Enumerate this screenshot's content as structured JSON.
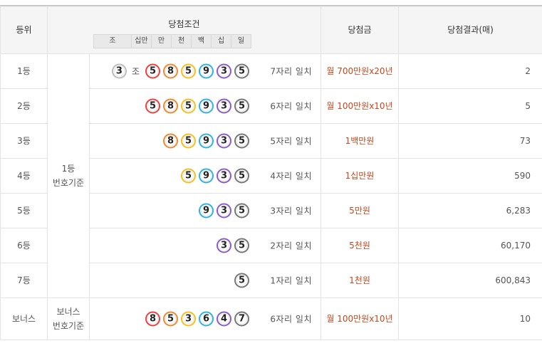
{
  "header": {
    "rank": "등위",
    "condition": "당첨조건",
    "prize": "당첨금",
    "result": "당첨결과(매)",
    "units": [
      "조",
      "십만",
      "만",
      "천",
      "백",
      "십",
      "일"
    ]
  },
  "groups": {
    "main": "1등\n번호기준",
    "bonus": "보너스\n번호기준"
  },
  "jo_label": "조",
  "rows": [
    {
      "rank": "1등",
      "jo": "3",
      "balls": [
        "5",
        "8",
        "5",
        "9",
        "3",
        "5"
      ],
      "match": "7자리 일치",
      "prize": "월 700만원x20년",
      "winners": "2"
    },
    {
      "rank": "2등",
      "balls": [
        "5",
        "8",
        "5",
        "9",
        "3",
        "5"
      ],
      "match": "6자리 일치",
      "prize": "월 100만원x10년",
      "winners": "5"
    },
    {
      "rank": "3등",
      "balls": [
        "8",
        "5",
        "9",
        "3",
        "5"
      ],
      "match": "5자리 일치",
      "prize": "1백만원",
      "winners": "73"
    },
    {
      "rank": "4등",
      "balls": [
        "5",
        "9",
        "3",
        "5"
      ],
      "match": "4자리 일치",
      "prize": "1십만원",
      "winners": "590"
    },
    {
      "rank": "5등",
      "balls": [
        "9",
        "3",
        "5"
      ],
      "match": "3자리 일치",
      "prize": "5만원",
      "winners": "6,283"
    },
    {
      "rank": "6등",
      "balls": [
        "3",
        "5"
      ],
      "match": "2자리 일치",
      "prize": "5천원",
      "winners": "60,170"
    },
    {
      "rank": "7등",
      "balls": [
        "5"
      ],
      "match": "1자리 일치",
      "prize": "1천원",
      "winners": "600,843"
    },
    {
      "rank": "보너스",
      "balls": [
        "8",
        "5",
        "3",
        "6",
        "4",
        "7"
      ],
      "match": "6자리 일치",
      "prize": "월 100만원x10년",
      "winners": "10"
    }
  ],
  "ball_colors": {
    "jo": "#bdbdbd",
    "sibman": "#e8423f",
    "man": "#f0892d",
    "cheon": "#f4c01e",
    "baek": "#2fb1e3",
    "sip": "#8b5cc7",
    "il": "#777777"
  }
}
